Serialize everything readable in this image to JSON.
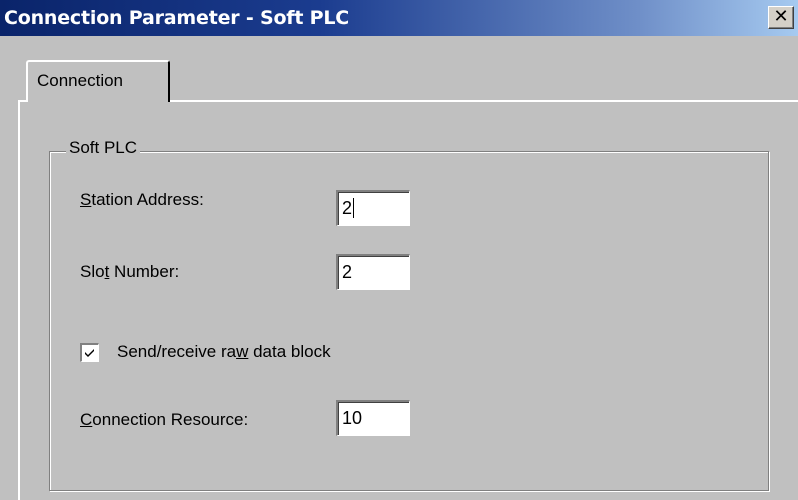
{
  "window": {
    "title": "Connection Parameter - Soft PLC",
    "close_glyph": "✕"
  },
  "tabs": [
    {
      "label": "Connection",
      "selected": true
    }
  ],
  "group": {
    "title": "Soft PLC"
  },
  "fields": {
    "station_address": {
      "label_mnemonic": "S",
      "label_rest": "tation Address:",
      "value": "2"
    },
    "slot_number": {
      "label_pre": "Slo",
      "label_mnemonic": "t",
      "label_rest": " Number:",
      "value": "2"
    },
    "connection_resource": {
      "label_mnemonic": "C",
      "label_rest": "onnection Resource:",
      "value": "10"
    }
  },
  "raw_data_checkbox": {
    "checked": true,
    "label_pre": "Send/receive ra",
    "label_mnemonic": "w",
    "label_rest": " data block"
  },
  "icons": {
    "close": "close-icon",
    "check": "checkmark-icon"
  }
}
